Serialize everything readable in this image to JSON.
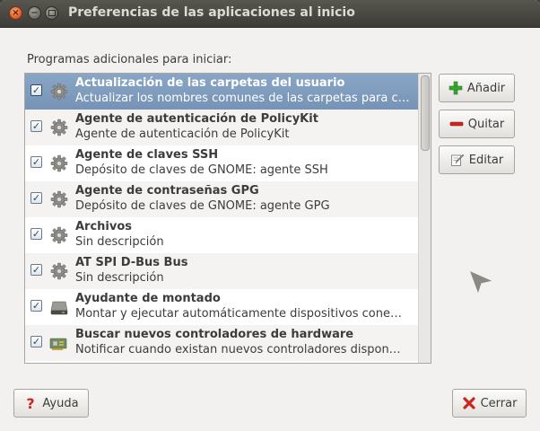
{
  "window": {
    "title": "Preferencias de las aplicaciones al inicio"
  },
  "section_label": "Programas adicionales para iniciar:",
  "programs": [
    {
      "name": "Actualización de las carpetas del usuario",
      "description": "Actualizar los nombres comunes de las carpetas para c…",
      "checked": true,
      "icon": "gear-icon",
      "selected": true
    },
    {
      "name": "Agente de autenticación de PolicyKit",
      "description": "Agente de autenticación de PolicyKit",
      "checked": true,
      "icon": "gear-icon"
    },
    {
      "name": "Agente de claves SSH",
      "description": "Depósito de claves de GNOME: agente SSH",
      "checked": true,
      "icon": "gear-icon"
    },
    {
      "name": "Agente de contraseñas GPG",
      "description": "Depósito de claves de GNOME: agente GPG",
      "checked": true,
      "icon": "gear-icon"
    },
    {
      "name": "Archivos",
      "description": "Sin descripción",
      "checked": true,
      "icon": "gear-icon"
    },
    {
      "name": "AT SPI D-Bus Bus",
      "description": "Sin descripción",
      "checked": true,
      "icon": "gear-icon"
    },
    {
      "name": "Ayudante de montado",
      "description": "Montar y ejecutar automáticamente dispositivos cone…",
      "checked": true,
      "icon": "drive-icon"
    },
    {
      "name": "Buscar nuevos controladores de hardware",
      "description": "Notificar cuando existan nuevos controladores dispon…",
      "checked": true,
      "icon": "hardware-card-icon"
    },
    {
      "name": "",
      "description": "",
      "checked": false,
      "icon": ""
    }
  ],
  "buttons": {
    "add": "Añadir",
    "remove": "Quitar",
    "edit": "Editar",
    "help": "Ayuda",
    "close": "Cerrar"
  },
  "icons": {
    "add": "plus-icon",
    "remove": "minus-icon",
    "edit": "edit-icon",
    "help": "help-icon",
    "close": "close-icon"
  },
  "colors": {
    "selection": "#7a96b8",
    "title_text": "#dfdbd2",
    "close_button": "#e4622c",
    "add_green": "#3aa52e",
    "remove_red": "#c8261f"
  }
}
